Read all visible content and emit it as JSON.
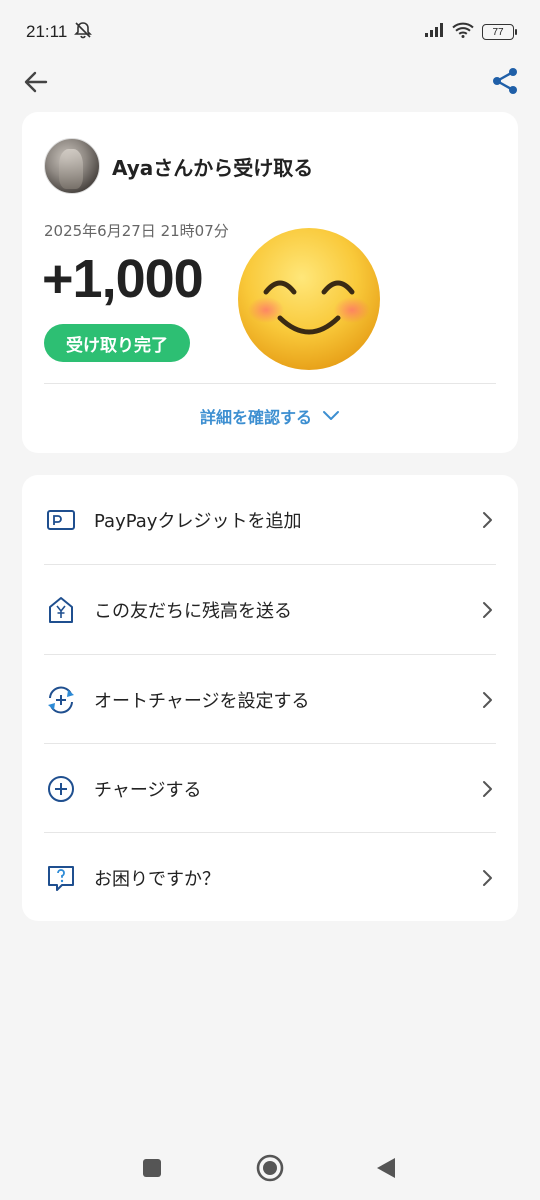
{
  "status_bar": {
    "time": "21:11",
    "battery": "77"
  },
  "app_bar": {
    "back_icon": "arrow-left-icon",
    "share_icon": "share-icon"
  },
  "transaction": {
    "sender_title": "Ayaさんから受け取る",
    "date": "2025年6月27日 21時07分",
    "amount": "+1,000",
    "status": "受け取り完了",
    "details_link": "詳細を確認する"
  },
  "menu": {
    "items": [
      {
        "label": "PayPayクレジットを追加",
        "icon": "credit-card-icon"
      },
      {
        "label": "この友だちに残高を送る",
        "icon": "yen-house-icon"
      },
      {
        "label": "オートチャージを設定する",
        "icon": "auto-charge-icon"
      },
      {
        "label": "チャージする",
        "icon": "plus-circle-icon"
      },
      {
        "label": "お困りですか？",
        "icon": "help-bubble-icon"
      }
    ]
  },
  "colors": {
    "accent": "#3d8fd1",
    "success": "#2dbf73",
    "icon": "#1f4f8f",
    "background": "#f5f5f5"
  }
}
